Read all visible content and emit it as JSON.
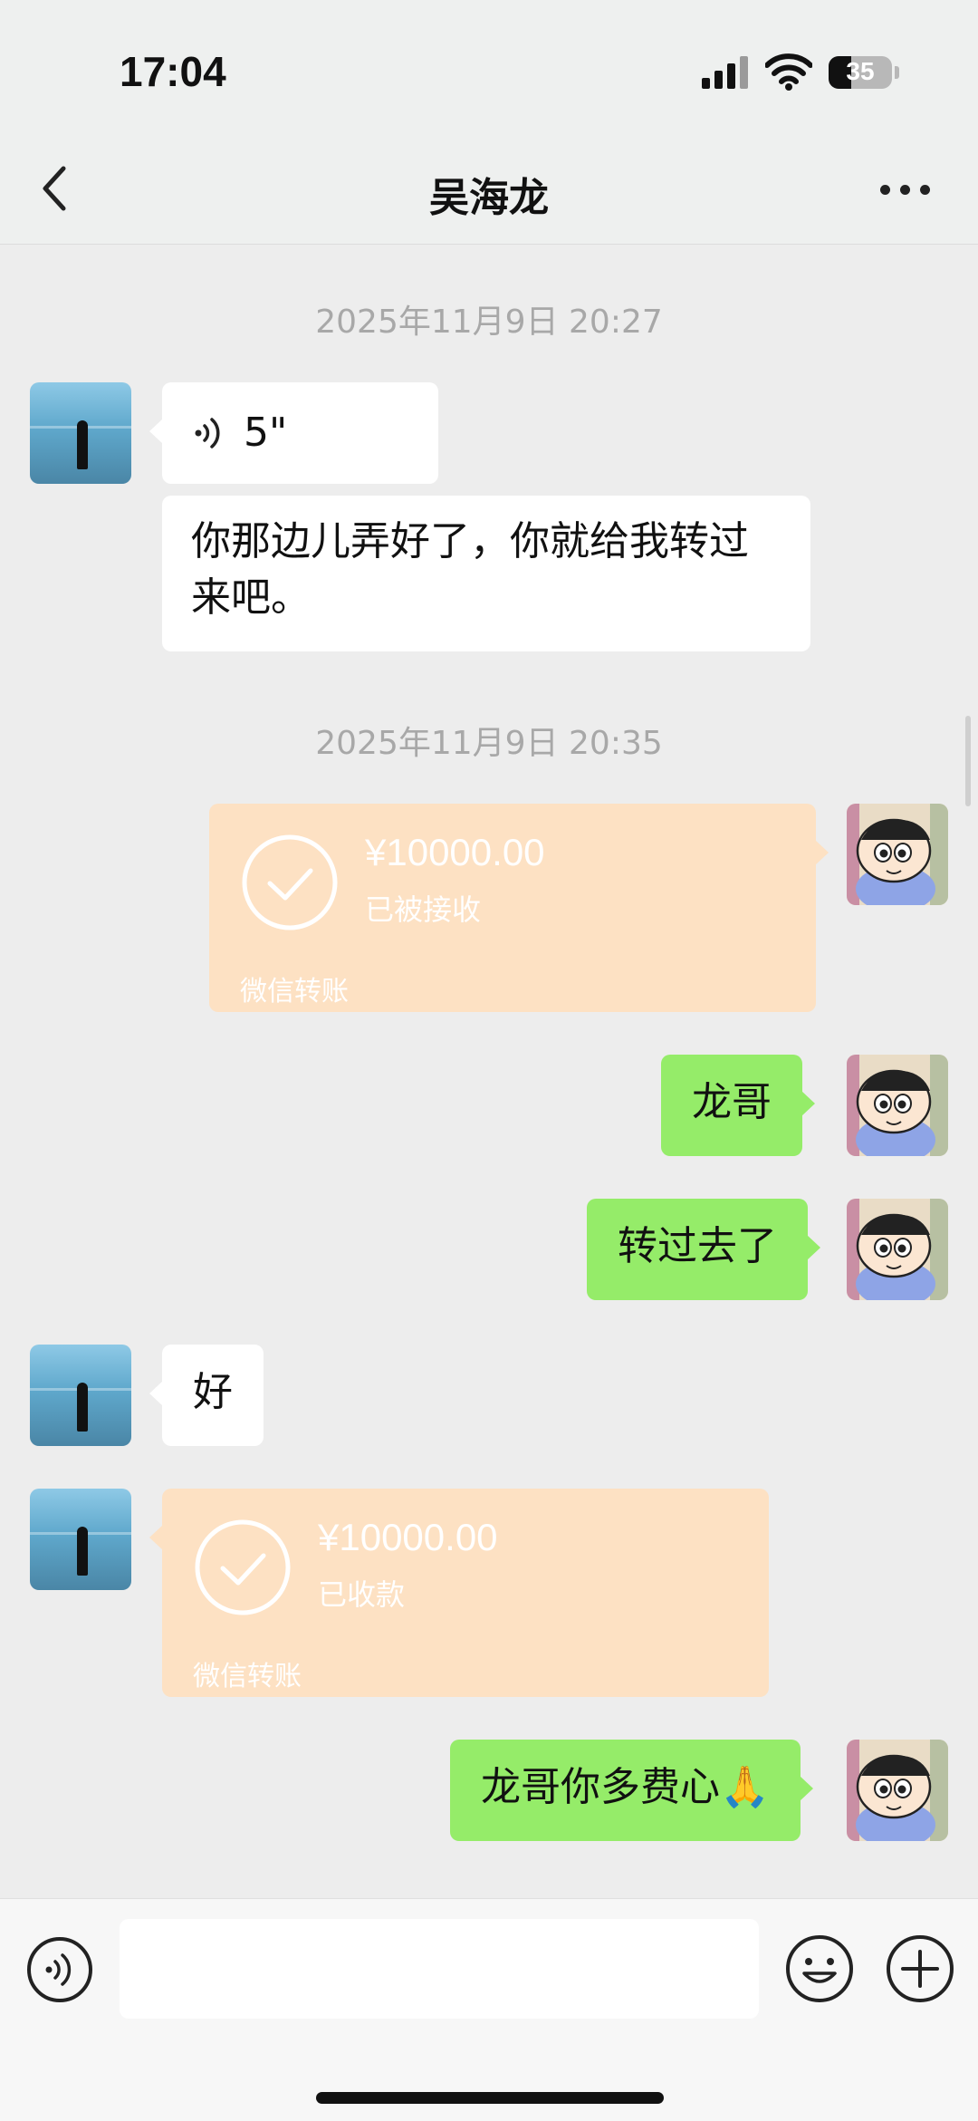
{
  "status_bar": {
    "time": "17:04",
    "battery_level": "35",
    "icons": [
      "signal-icon",
      "wifi-icon",
      "battery-icon"
    ]
  },
  "nav": {
    "title": "吴海龙",
    "back_icon": "chevron-left-icon",
    "more_icon": "more-dots-icon"
  },
  "messages": {
    "ts1": "2025年11月9日 20:27",
    "voice_duration": "5\"",
    "text1": "你那边儿弄好了，你就给我转过来吧。",
    "ts2": "2025年11月9日 20:35",
    "transfer1": {
      "amount": "¥10000.00",
      "status": "已被接收",
      "brand": "微信转账"
    },
    "out1": "龙哥",
    "out2": "转过去了",
    "in2": "好",
    "transfer2": {
      "amount": "¥10000.00",
      "status": "已收款",
      "brand": "微信转账"
    },
    "out3": "龙哥你多费心🙏"
  },
  "input_bar": {
    "placeholder": "",
    "icons": [
      "voice-toggle-icon",
      "emoji-icon",
      "plus-icon"
    ]
  },
  "colors": {
    "bubble_out": "#95ec69",
    "bubble_in": "#ffffff",
    "transfer_card": "#fde1c3",
    "background": "#ededed"
  }
}
